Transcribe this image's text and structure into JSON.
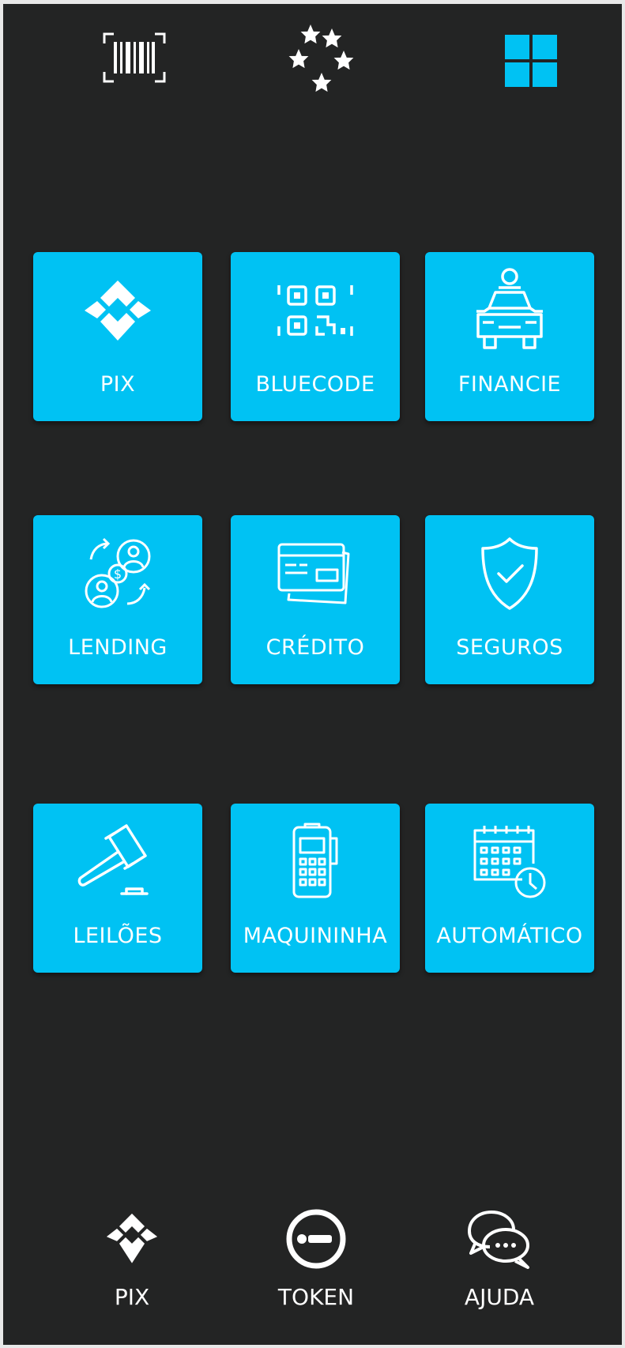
{
  "topbar": {
    "barcode_icon": "barcode-scan-icon",
    "stars_icon": "stars-icon",
    "grid_icon": "grid-icon"
  },
  "tiles": [
    {
      "label": "PIX",
      "icon": "pix-icon"
    },
    {
      "label": "BLUECODE",
      "icon": "qr-code-icon"
    },
    {
      "label": "FINANCIE",
      "icon": "car-icon"
    },
    {
      "label": "LENDING",
      "icon": "lending-icon"
    },
    {
      "label": "CRÉDITO",
      "icon": "credit-card-icon"
    },
    {
      "label": "SEGUROS",
      "icon": "shield-check-icon"
    },
    {
      "label": "LEILÕES",
      "icon": "gavel-icon"
    },
    {
      "label": "MAQUININHA",
      "icon": "card-machine-icon"
    },
    {
      "label": "AUTOMÁTICO",
      "icon": "calendar-clock-icon"
    }
  ],
  "bottom_nav": [
    {
      "label": "PIX",
      "icon": "pix-icon"
    },
    {
      "label": "TOKEN",
      "icon": "token-icon"
    },
    {
      "label": "AJUDA",
      "icon": "chat-icon"
    }
  ],
  "colors": {
    "background": "#232424",
    "accent": "#00c2f3",
    "text": "#ffffff"
  }
}
